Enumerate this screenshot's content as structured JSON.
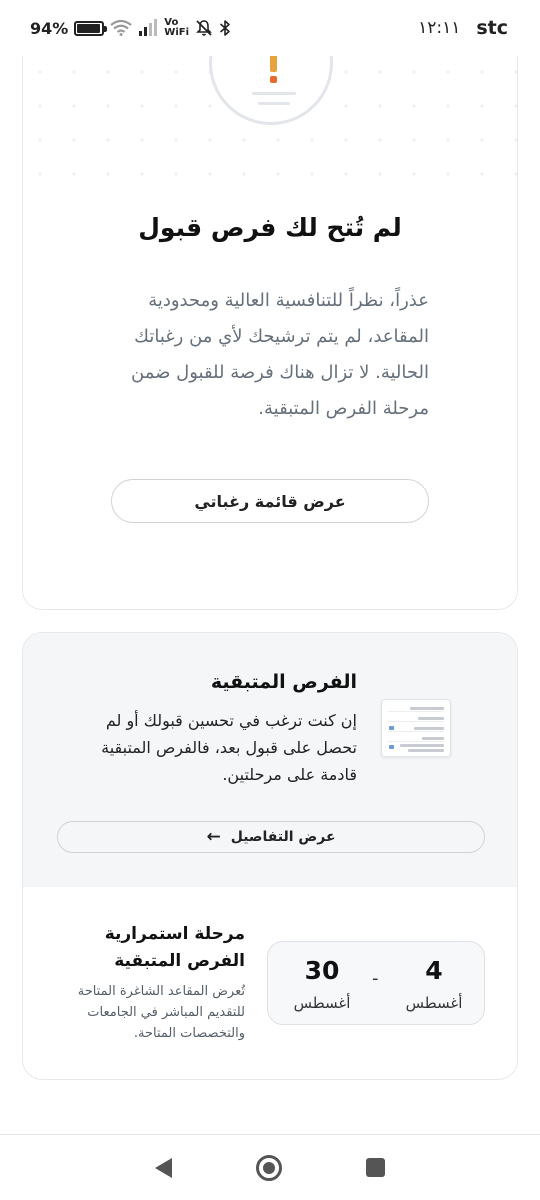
{
  "status_bar": {
    "battery_percent": "94%",
    "battery_level": 0.94,
    "vowifi_top": "Vo",
    "vowifi_bottom": "WiFi",
    "time": "١٢:١١",
    "carrier": "stc",
    "icons": [
      "battery-icon",
      "wifi-icon",
      "signal-icon",
      "vowifi-icon",
      "mute-icon",
      "bluetooth-icon"
    ]
  },
  "result_card": {
    "icon": "warning-document-icon",
    "title": "لم تُتح لك فرص قبول",
    "message": "عذراً، نظراً للتنافسية العالية ومحدودية المقاعد، لم يتم ترشيحك لأي من رغباتك الحالية. لا تزال هناك فرصة للقبول ضمن مرحلة الفرص المتبقية.",
    "wishlist_button": "عرض قائمة رغباتي"
  },
  "remaining_card": {
    "title": "الفرص المتبقية",
    "description": "إن كنت ترغب في تحسين قبولك أو لم تحصل على قبول بعد، فالفرص المتبقية قادمة على مرحلتين.",
    "details_button": "عرض التفاصيل",
    "details_icon": "arrow-left-icon",
    "stage": {
      "title": "مرحلة استمرارية الفرص المتبقية",
      "description": "تُعرض المقاعد الشاغرة المتاحة للتقديم المباشر في الجامعات والتخصصات المتاحة.",
      "start_day": "4",
      "start_month": "أغسطس",
      "separator": "-",
      "end_day": "30",
      "end_month": "أغسطس"
    }
  },
  "nav_bar": {
    "icons": [
      "back-icon",
      "home-icon",
      "recents-icon"
    ]
  },
  "colors": {
    "warning_orange": "#e86a2c",
    "card_border": "#e6e8ec",
    "muted_text": "#66707a"
  }
}
